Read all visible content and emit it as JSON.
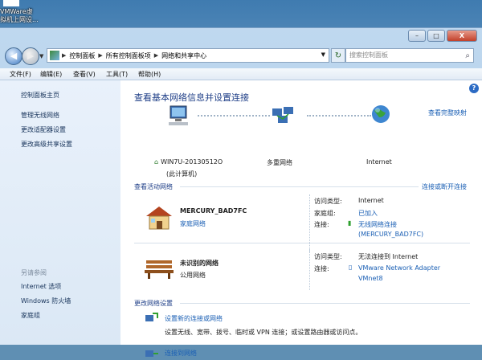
{
  "desktop": {
    "icon_label_line1": "VMWare虚",
    "icon_label_line2": "拟机上网设..."
  },
  "window": {
    "controls": {
      "minimize": "–",
      "maximize": "□",
      "close": "X"
    }
  },
  "address_bar": {
    "back_glyph": "◀",
    "forward_glyph": "▶",
    "breadcrumbs": [
      "控制面板",
      "所有控制面板项",
      "网络和共享中心"
    ],
    "search_placeholder": "搜索控制面板"
  },
  "menu": [
    "文件(F)",
    "编辑(E)",
    "查看(V)",
    "工具(T)",
    "帮助(H)"
  ],
  "sidebar": {
    "home": "控制面板主页",
    "links": [
      "管理无线网络",
      "更改适配器设置",
      "更改高级共享设置"
    ],
    "see_also": "另请参阅",
    "see_also_links": [
      "Internet 选项",
      "Windows 防火墙",
      "家庭组"
    ]
  },
  "main": {
    "title": "查看基本网络信息并设置连接",
    "view_full_map": "查看完整映射",
    "map": {
      "computer_name": "WIN7U-20130512O",
      "computer_sub": "(此计算机)",
      "multi_network": "多重网络",
      "internet": "Internet"
    },
    "active_networks_header": "查看活动网络",
    "connect_disconnect": "连接或断开连接",
    "networks": [
      {
        "name": "MERCURY_BAD7FC",
        "type": "家庭网络",
        "access_label": "访问类型:",
        "access_value": "Internet",
        "homegroup_label": "家庭组:",
        "homegroup_value": "已加入",
        "conn_label": "连接:",
        "conn_value_1": "无线网络连接",
        "conn_value_2": "(MERCURY_BAD7FC)"
      },
      {
        "name": "未识别的网络",
        "type": "公用网络",
        "access_label": "访问类型:",
        "access_value": "无法连接到 Internet",
        "conn_label": "连接:",
        "conn_value_1": "VMware Network Adapter",
        "conn_value_2": "VMnet8"
      }
    ],
    "change_settings_header": "更改网络设置",
    "tasks": [
      {
        "title": "设置新的连接或网络",
        "desc": "设置无线、宽带、拨号、临时或 VPN 连接；或设置路由器或访问点。"
      },
      {
        "title": "连接到网络",
        "desc": ""
      }
    ]
  }
}
